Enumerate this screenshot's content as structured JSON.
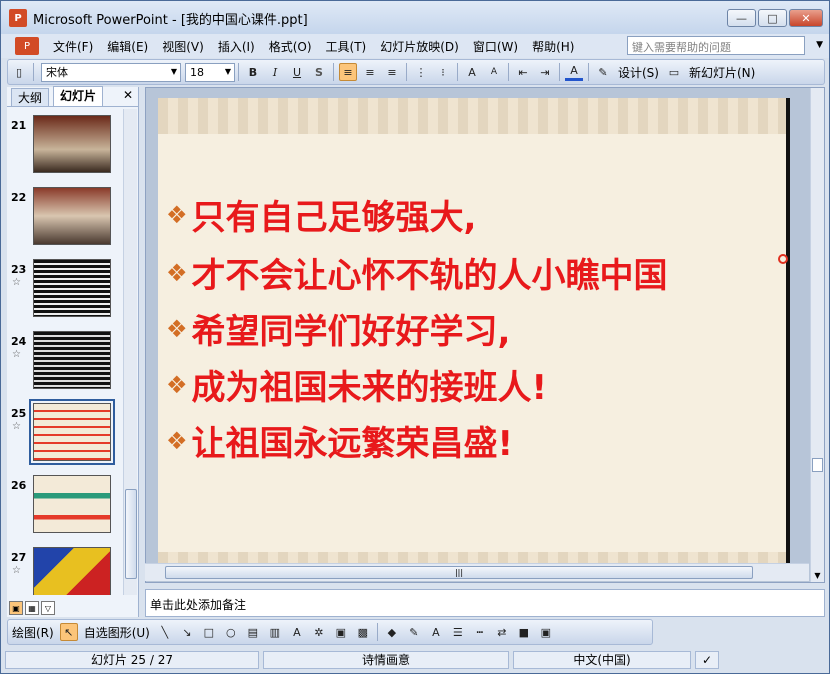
{
  "window": {
    "title": "Microsoft PowerPoint - [我的中国心课件.ppt]",
    "app_icon": "powerpoint-icon"
  },
  "menu": {
    "items": [
      {
        "label": "文件(F)"
      },
      {
        "label": "编辑(E)"
      },
      {
        "label": "视图(V)"
      },
      {
        "label": "插入(I)"
      },
      {
        "label": "格式(O)"
      },
      {
        "label": "工具(T)"
      },
      {
        "label": "幻灯片放映(D)"
      },
      {
        "label": "窗口(W)"
      },
      {
        "label": "帮助(H)"
      }
    ],
    "help_placeholder": "键入需要帮助的问题"
  },
  "toolbar": {
    "font_name": "宋体",
    "font_size": "18",
    "bold": "B",
    "italic": "I",
    "underline": "U",
    "shadow": "S",
    "design_label": "设计(S)",
    "new_slide_label": "新幻灯片(N)"
  },
  "left_panel": {
    "tabs": [
      {
        "label": "大纲"
      },
      {
        "label": "幻灯片"
      }
    ],
    "close": "✕",
    "thumbnails": [
      {
        "number": "21",
        "has_star": false
      },
      {
        "number": "22",
        "has_star": false
      },
      {
        "number": "23",
        "has_star": true
      },
      {
        "number": "24",
        "has_star": true
      },
      {
        "number": "25",
        "has_star": true,
        "selected": true
      },
      {
        "number": "26",
        "has_star": false
      },
      {
        "number": "27",
        "has_star": true
      }
    ]
  },
  "slide": {
    "lines": [
      "只有自己足够强大,",
      "才不会让心怀不轨的人小瞧中国",
      "希望同学们好好学习,",
      "成为祖国未来的接班人!",
      "让祖国永远繁荣昌盛!"
    ],
    "text_color": "#e8191b",
    "bullet_color": "#d36e25"
  },
  "notes": {
    "placeholder": "单击此处添加备注"
  },
  "drawing_toolbar": {
    "draw_label": "绘图(R)",
    "autoshapes_label": "自选图形(U)"
  },
  "status": {
    "slide_indicator": "幻灯片 25 / 27",
    "design_name": "诗情画意",
    "language": "中文(中国)"
  }
}
